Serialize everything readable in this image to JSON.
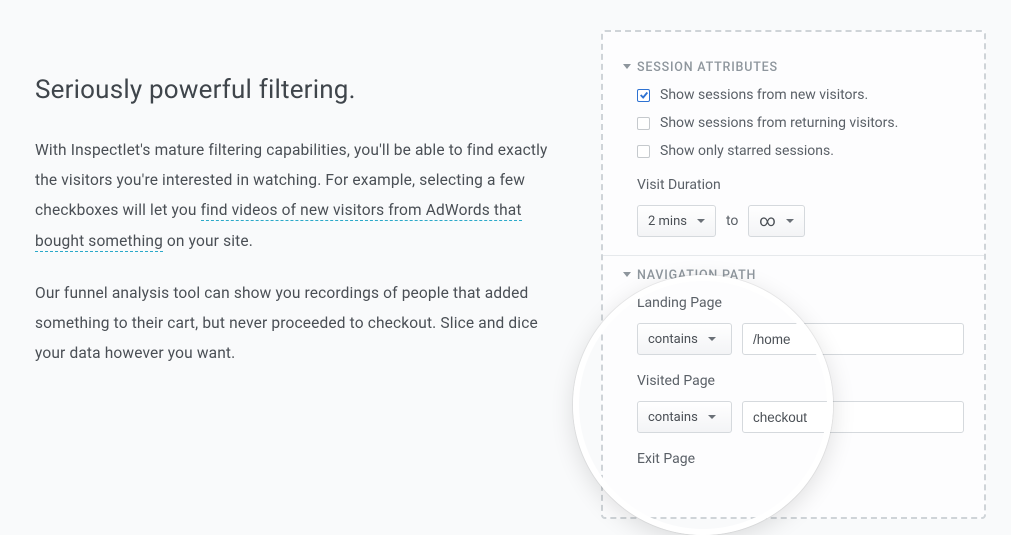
{
  "left": {
    "heading": "Seriously powerful filtering.",
    "p1a": "With Inspectlet's mature filtering capabilities, you'll be able to find exactly the visitors you're interested in watching. For example, selecting a few checkboxes will let you ",
    "p1_link": "find videos of new visitors from AdWords that bought something",
    "p1b": " on your site.",
    "p2": "Our funnel analysis tool can show you recordings of people that added something to their cart, but never proceeded to checkout. Slice and dice your data however you want."
  },
  "panel": {
    "session_attributes_header": "SESSION ATTRIBUTES",
    "checks": [
      {
        "label": "Show sessions from new visitors.",
        "checked": true
      },
      {
        "label": "Show sessions from returning visitors.",
        "checked": false
      },
      {
        "label": "Show only starred sessions.",
        "checked": false
      }
    ],
    "visit_duration_label": "Visit Duration",
    "duration_from": "2 mins",
    "duration_to_word": "to",
    "duration_to": "∞",
    "nav_header": "NAVIGATION PATH",
    "landing_label": "Landing Page",
    "landing_op": "contains",
    "landing_val": "/home",
    "visited_label": "Visited Page",
    "visited_op": "contains",
    "visited_val": "checkout",
    "exit_label": "Exit Page"
  }
}
